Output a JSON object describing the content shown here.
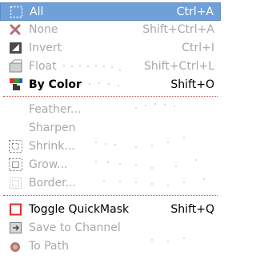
{
  "menu": {
    "items": [
      {
        "label": "All",
        "accel": "Ctrl+A",
        "icon": "select-all-icon",
        "state": "active"
      },
      {
        "label": "None",
        "accel": "Shift+Ctrl+A",
        "icon": "select-none-icon",
        "state": "disabled"
      },
      {
        "label": "Invert",
        "accel": "Ctrl+I",
        "icon": "invert-selection-icon",
        "state": "disabled"
      },
      {
        "label": "Float",
        "accel": "Shift+Ctrl+L",
        "icon": "float-selection-icon",
        "state": "disabled"
      },
      {
        "label": "By Color",
        "accel": "Shift+O",
        "icon": "select-by-color-icon",
        "state": "enabled"
      },
      {
        "label": "Feather...",
        "accel": "",
        "icon": "",
        "state": "disabled"
      },
      {
        "label": "Sharpen",
        "accel": "",
        "icon": "",
        "state": "disabled"
      },
      {
        "label": "Shrink...",
        "accel": "",
        "icon": "shrink-selection-icon",
        "state": "disabled"
      },
      {
        "label": "Grow...",
        "accel": "",
        "icon": "grow-selection-icon",
        "state": "disabled"
      },
      {
        "label": "Border...",
        "accel": "",
        "icon": "border-selection-icon",
        "state": "disabled"
      },
      {
        "label": "Toggle QuickMask",
        "accel": "Shift+Q",
        "icon": "quickmask-toggle-icon",
        "state": "enabled"
      },
      {
        "label": "Save to Channel",
        "accel": "",
        "icon": "save-to-channel-icon",
        "state": "disabled"
      },
      {
        "label": "To Path",
        "accel": "",
        "icon": "selection-to-path-icon",
        "state": "disabled"
      }
    ]
  },
  "colors": {
    "highlight": "#6fa0d9",
    "quickmask_red": "#e0302a",
    "disabled_text": "#a9a9a9"
  }
}
